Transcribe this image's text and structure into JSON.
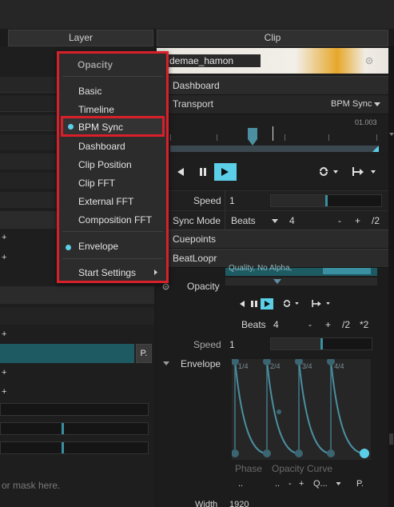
{
  "tabs": {
    "layer": "Layer",
    "clip": "Clip"
  },
  "clip_panel": {
    "thumbnail_name": "demae_hamon",
    "dashboard": "Dashboard",
    "transport": "Transport",
    "transport_mode": "BPM Sync",
    "timeline_value": "01.003",
    "speed_label": "Speed",
    "speed_value": "1",
    "sync_mode_label": "Sync Mode",
    "sync_mode_value": "Beats",
    "sync_mode_count": "4",
    "minus": "-",
    "plus": "+",
    "divide": "/2",
    "cuepoints": "Cuepoints",
    "beatloopr": "BeatLoopr"
  },
  "layer_panel": {
    "quality_text": "Quality, No Alpha,",
    "opacity_label": "Opacity",
    "beats_label": "Beats",
    "beats_value": "4",
    "minus": "-",
    "plus": "+",
    "divide": "/2",
    "multiply": "*2",
    "speed_label": "Speed",
    "speed_value": "1",
    "envelope_label": "Envelope",
    "envelope_marks": [
      "1/4",
      "2/4",
      "3/4",
      "4/4"
    ],
    "phase_label": "Phase",
    "opacity_curve_label": "Opacity Curve",
    "dots1": "..",
    "dots2": "..",
    "minus2": "-",
    "plus2": "+",
    "q_value": "Q...",
    "p_button": "P.",
    "width_label": "Width",
    "width_value": "1920",
    "mask_hint": "or mask here.",
    "p_badge": "P.",
    "plus_marks": [
      "+",
      "+",
      "+",
      "+",
      "+"
    ]
  },
  "context_menu": {
    "title": "Opacity",
    "items": [
      {
        "label": "Basic",
        "selected": false
      },
      {
        "label": "Timeline",
        "selected": false
      },
      {
        "label": "BPM Sync",
        "selected": true
      },
      {
        "label": "Dashboard",
        "selected": false
      },
      {
        "label": "Clip Position",
        "selected": false
      },
      {
        "label": "Clip FFT",
        "selected": false
      },
      {
        "label": "External FFT",
        "selected": false
      },
      {
        "label": "Composition FFT",
        "selected": false
      },
      {
        "label": "Envelope",
        "selected": true
      },
      {
        "label": "Start Settings",
        "selected": false
      }
    ]
  },
  "colors": {
    "accent": "#5ccfe8",
    "highlight_border": "#d8202a",
    "teal": "#1e5a62"
  },
  "icons": [
    "gear-icon",
    "chevron-down-icon",
    "chevron-right-icon",
    "play-icon",
    "pause-icon",
    "prev-icon",
    "loop-icon",
    "bounce-icon"
  ]
}
